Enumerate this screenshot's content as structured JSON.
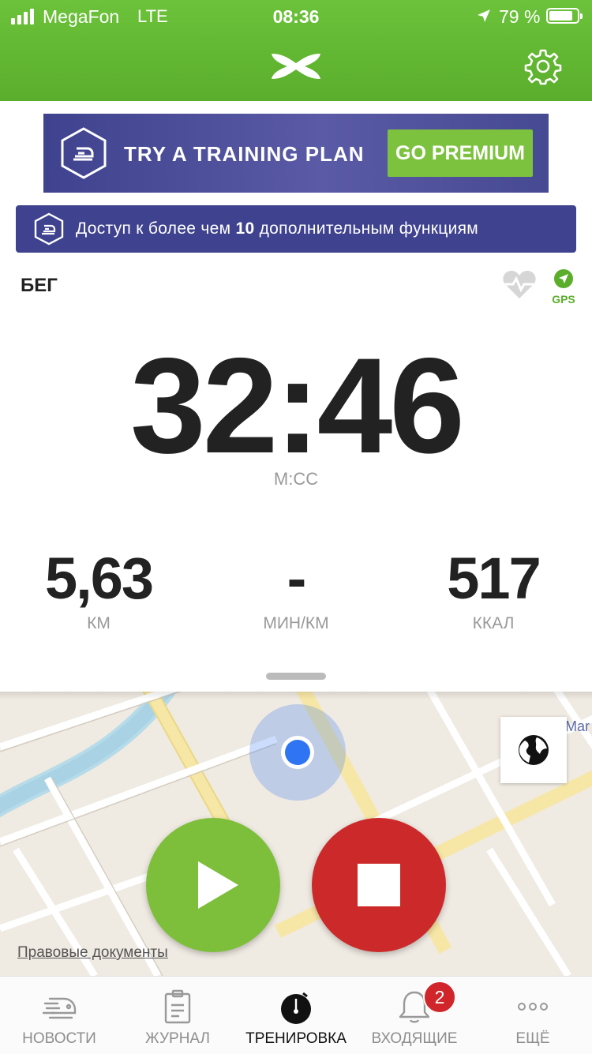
{
  "status_bar": {
    "carrier": "MegaFon",
    "network": "LTE",
    "time": "08:36",
    "battery": "79 %",
    "battery_level": 0.79
  },
  "header": {
    "logo_icon": "under-armour-logo",
    "settings_icon": "gear-icon"
  },
  "banner": {
    "text": "TRY A TRAINING PLAN",
    "button": "GO PREMIUM"
  },
  "access": {
    "prefix": "Доступ к более чем ",
    "count": "10",
    "suffix": " дополнительным функциям"
  },
  "workout": {
    "activity": "БЕГ",
    "gps_label": "GPS",
    "timer": "32:46",
    "timer_unit": "М:СС",
    "stats": [
      {
        "value": "5,63",
        "unit": "КМ"
      },
      {
        "value": "-",
        "unit": "МИН/КМ"
      },
      {
        "value": "517",
        "unit": "ККАЛ"
      }
    ]
  },
  "map": {
    "legal": "Правовые документы",
    "poi_label": "Mar"
  },
  "tabs": [
    {
      "label": "НОВОСТИ",
      "icon": "shoe-icon",
      "active": false
    },
    {
      "label": "ЖУРНАЛ",
      "icon": "clipboard-icon",
      "active": false
    },
    {
      "label": "ТРЕНИРОВКА",
      "icon": "stopwatch-icon",
      "active": true
    },
    {
      "label": "ВХОДЯЩИЕ",
      "icon": "bell-icon",
      "active": false
    },
    {
      "label": "ЕЩЁ",
      "icon": "more-icon",
      "active": false
    }
  ],
  "inbox_badge": "2",
  "colors": {
    "header_green": "#5aae2c",
    "premium_green": "#7dc23f",
    "banner_purple": "#3f428e",
    "stop_red": "#cc2a2a",
    "play_green": "#7dbf3a",
    "location_blue": "#2f74f2"
  }
}
